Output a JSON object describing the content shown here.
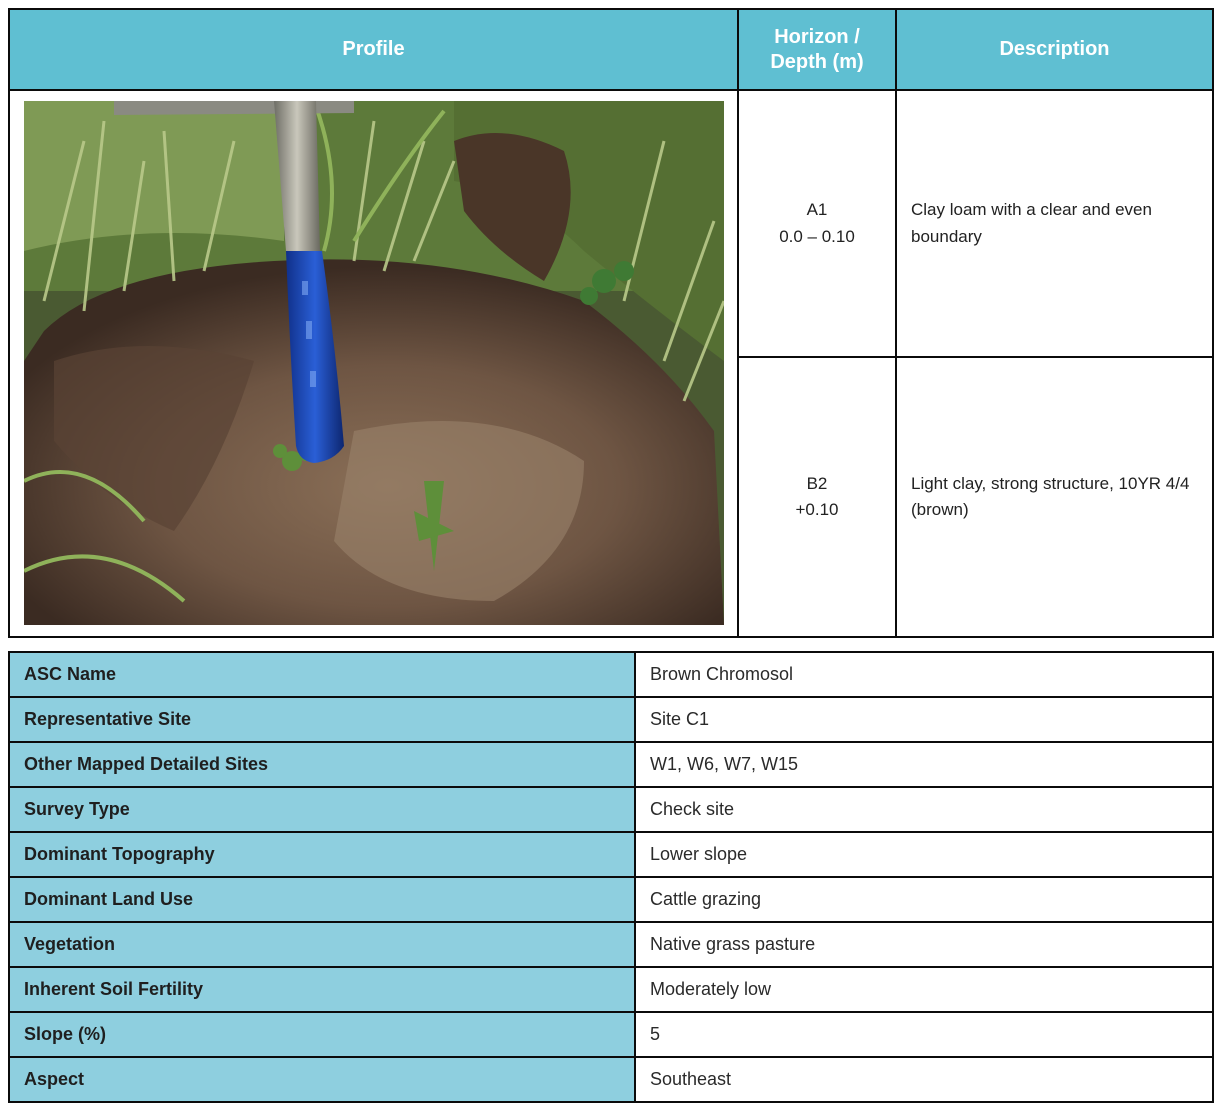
{
  "header": {
    "profile": "Profile",
    "horizon_line1": "Horizon /",
    "horizon_line2": "Depth (m)",
    "description": "Description"
  },
  "horizons": [
    {
      "name": "A1",
      "depth": "0.0 – 0.10",
      "description": "Clay loam with a clear and even boundary"
    },
    {
      "name": "B2",
      "depth": "+0.10",
      "description": "Light clay, strong structure, 10YR 4/4 (brown)"
    }
  ],
  "attributes": [
    {
      "label": "ASC Name",
      "value": "Brown Chromosol"
    },
    {
      "label": "Representative Site",
      "value": "Site C1"
    },
    {
      "label": "Other Mapped Detailed Sites",
      "value": "W1, W6, W7, W15"
    },
    {
      "label": "Survey Type",
      "value": "Check site"
    },
    {
      "label": "Dominant Topography",
      "value": "Lower slope"
    },
    {
      "label": "Dominant Land Use",
      "value": "Cattle grazing"
    },
    {
      "label": "Vegetation",
      "value": "Native grass pasture"
    },
    {
      "label": "Inherent Soil Fertility",
      "value": "Moderately low"
    },
    {
      "label": "Slope (%)",
      "value": "5"
    },
    {
      "label": "Aspect",
      "value": "Southeast"
    }
  ],
  "colors": {
    "header_bg": "#5fbfd2",
    "label_bg": "#8ecfdf",
    "border": "#0b0b0b"
  }
}
